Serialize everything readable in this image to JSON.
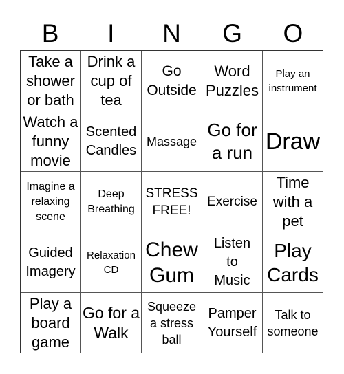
{
  "title_letters": [
    "B",
    "I",
    "N",
    "G",
    "O"
  ],
  "cells": [
    [
      "Take a shower or bath",
      "Drink a cup of tea",
      "Go Outside",
      "Word Puzzles",
      "Play an instrument"
    ],
    [
      "Watch a funny movie",
      "Scented Candles",
      "Massage",
      "Go for a run",
      "Draw"
    ],
    [
      "Imagine a relaxing scene",
      "Deep Breathing",
      "STRESS FREE!",
      "Exercise",
      "Time with a pet"
    ],
    [
      "Guided Imagery",
      "Relaxation CD",
      "Chew Gum",
      "Listen to Music",
      "Play Cards"
    ],
    [
      "Play a board game",
      "Go for a Walk",
      "Squeeze a stress ball",
      "Pamper Yourself",
      "Talk to someone"
    ]
  ]
}
